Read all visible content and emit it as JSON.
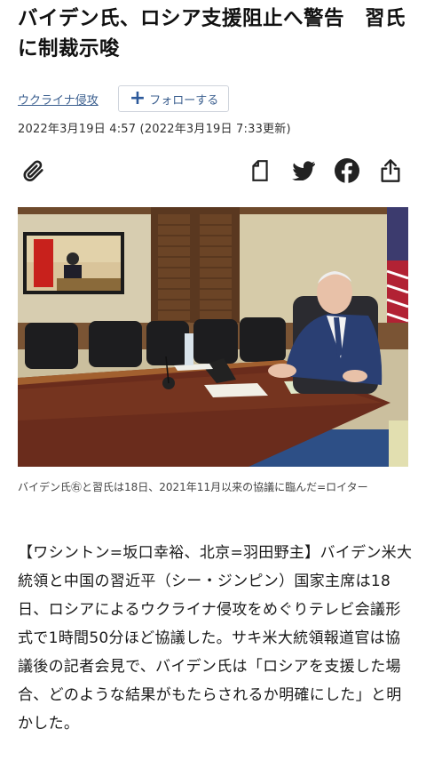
{
  "article": {
    "headline": "バイデン氏、ロシア支援阻止へ警告　習氏に制裁示唆",
    "topic": "ウクライナ侵攻",
    "follow_label": "フォローする",
    "timestamp": "2022年3月19日 4:57 (2022年3月19日 7:33更新)",
    "caption": "バイデン氏㊨と習氏は18日、2021年11月以来の協議に臨んだ=ロイター",
    "body": "【ワシントン=坂口幸裕、北京=羽田野主】バイデン米大統領と中国の習近平（シー・ジンピン）国家主席は18日、ロシアによるウクライナ侵攻をめぐりテレビ会議形式で1時間50分ほど協議した。サキ米大統領報道官は協議後の記者会見で、バイデン氏は「ロシアを支援した場合、どのような結果がもたらされるか明確にした」と明かした。"
  },
  "share_icons": [
    "paperclip-icon",
    "bookmark-icon",
    "twitter-icon",
    "facebook-icon",
    "share-icon"
  ],
  "colors": {
    "link": "#3b5f8f",
    "accent": "#2d5a9b",
    "text": "#1a1a1a"
  }
}
